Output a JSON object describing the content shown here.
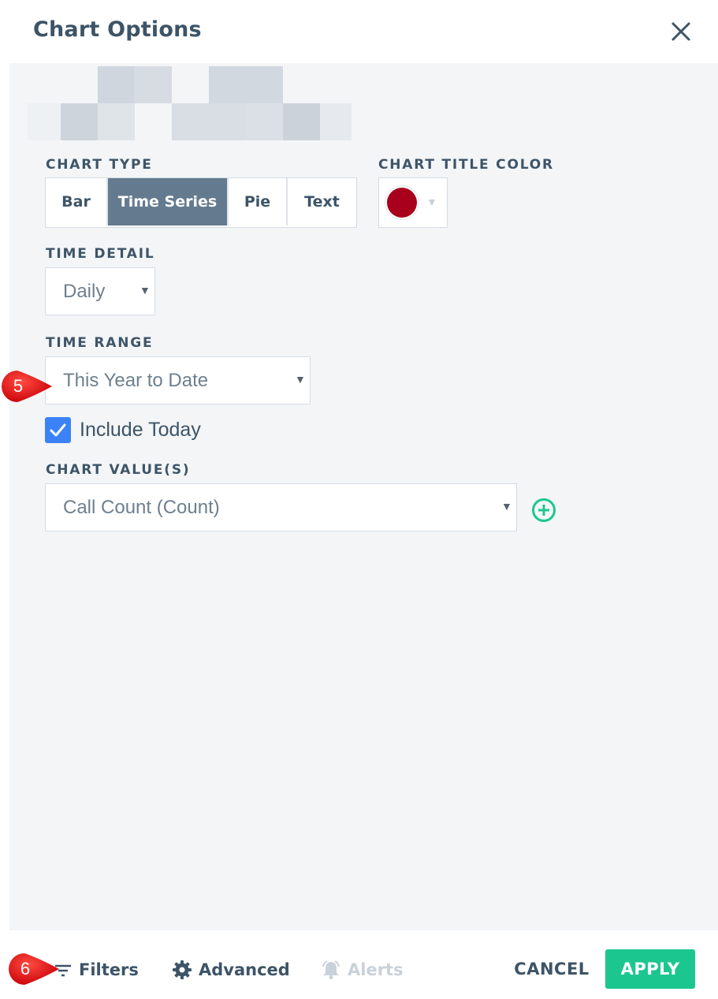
{
  "dialog": {
    "title": "Chart Options"
  },
  "chart_type": {
    "label": "CHART TYPE",
    "options": [
      "Bar",
      "Time Series",
      "Pie",
      "Text"
    ],
    "selected": "Time Series"
  },
  "chart_title_color": {
    "label": "CHART TITLE COLOR",
    "value": "#a8001c"
  },
  "time_detail": {
    "label": "TIME DETAIL",
    "value": "Daily"
  },
  "time_range": {
    "label": "TIME RANGE",
    "value": "This Year to Date"
  },
  "include_today": {
    "label": "Include Today",
    "checked": true
  },
  "chart_values": {
    "label": "CHART VALUE(S)",
    "value": "Call Count (Count)"
  },
  "footer": {
    "filters": "Filters",
    "advanced": "Advanced",
    "alerts": "Alerts",
    "cancel": "CANCEL",
    "apply": "APPLY"
  },
  "callouts": {
    "time_range": "5",
    "filters": "6"
  },
  "colors": {
    "accent_blue": "#3b82f6",
    "accent_green": "#1cc78f",
    "segment_active": "#647b8f",
    "callout_red": "#e8000b"
  },
  "icons": [
    "close-icon",
    "chevron-down-icon",
    "checkmark-icon",
    "plus-circle-icon",
    "filter-icon",
    "gear-icon",
    "bell-icon"
  ]
}
